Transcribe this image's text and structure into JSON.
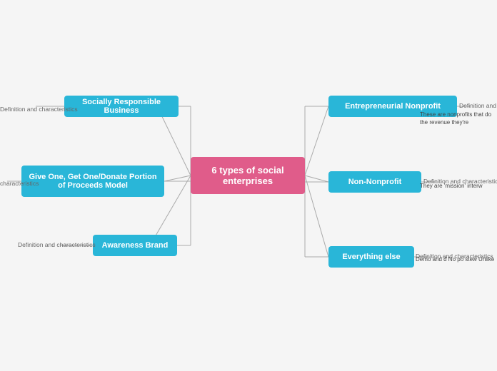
{
  "mindmap": {
    "center": {
      "label": "6 types of social enterprises"
    },
    "left_nodes": [
      {
        "id": "srb",
        "label": "Socially Responsible Business",
        "connector_label": "Definition and characteristics"
      },
      {
        "id": "give-one",
        "label": "Give One, Get One/Donate Portion of Proceeds Model",
        "connector_label": "characteristics"
      },
      {
        "id": "awareness",
        "label": "Awareness Brand",
        "connector_label": "Definition and characteristics"
      }
    ],
    "right_nodes": [
      {
        "id": "entrepreneurial",
        "label": "Entrepreneurial Nonprofit",
        "connector_label": "Definition and characteristics",
        "description": "These are nonprofits that do the revenue they're"
      },
      {
        "id": "nonprofit",
        "label": "Non-Nonprofit",
        "connector_label": "Definition and characteristics",
        "description": "They are 'mission' interw"
      },
      {
        "id": "everything",
        "label": "Everything else",
        "connector_label": "Definition and characteristics",
        "description": "Demo and d No po stew Unlike"
      }
    ]
  }
}
